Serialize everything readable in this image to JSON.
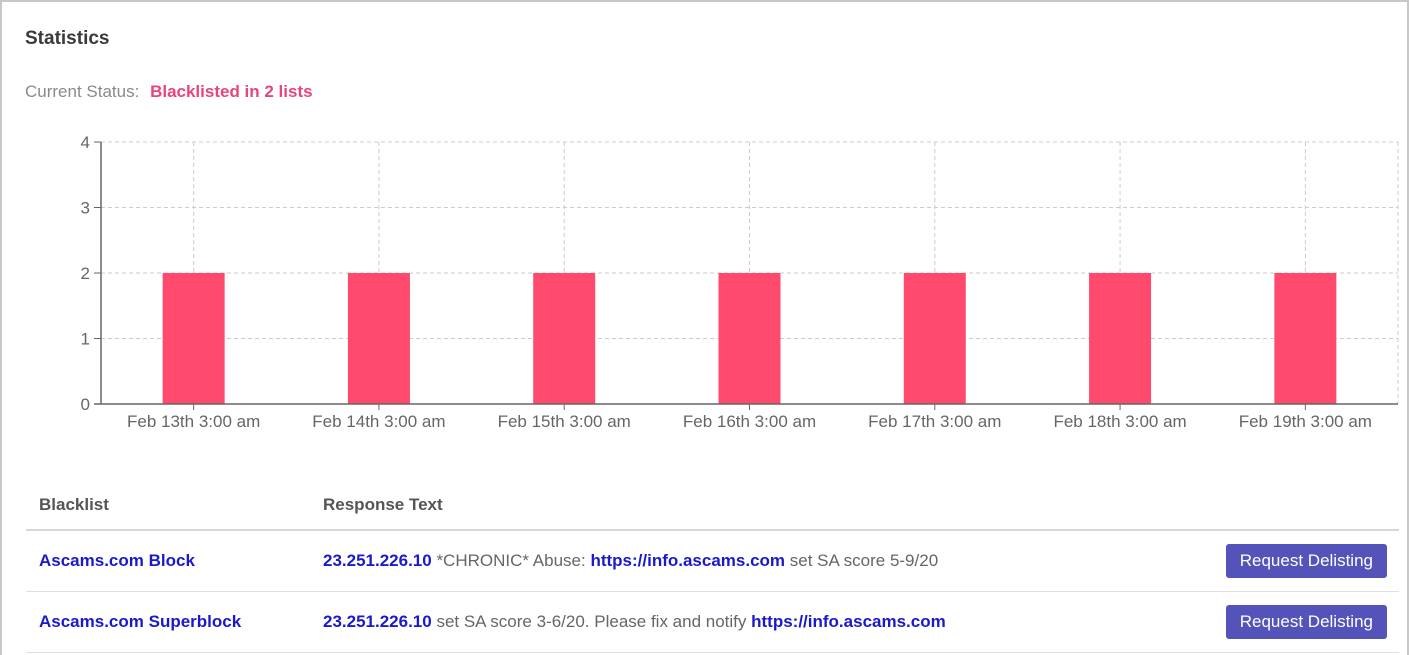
{
  "panel": {
    "title": "Statistics"
  },
  "status": {
    "label": "Current Status:",
    "value": "Blacklisted in 2 lists"
  },
  "colors": {
    "bar": "#ff4a6e",
    "status": "#e8457a",
    "link": "#1a1acc",
    "button": "#5353b9"
  },
  "chart_data": {
    "type": "bar",
    "categories": [
      "Feb 13th 3:00 am",
      "Feb 14th 3:00 am",
      "Feb 15th 3:00 am",
      "Feb 16th 3:00 am",
      "Feb 17th 3:00 am",
      "Feb 18th 3:00 am",
      "Feb 19th 3:00 am"
    ],
    "values": [
      2,
      2,
      2,
      2,
      2,
      2,
      2
    ],
    "title": "",
    "xlabel": "",
    "ylabel": "",
    "ylim": [
      0,
      4
    ],
    "yticks": [
      0,
      1,
      2,
      3,
      4
    ],
    "grid": true,
    "color": "#ff4a6e"
  },
  "table": {
    "headers": {
      "blacklist": "Blacklist",
      "response": "Response Text"
    },
    "rows": [
      {
        "name": "Ascams.com Block",
        "ip": "23.251.226.10",
        "text_before": " *CHRONIC* Abuse: ",
        "link": "https://info.ascams.com",
        "text_after": " set SA score 5-9/20",
        "action": "Request Delisting"
      },
      {
        "name": "Ascams.com Superblock",
        "ip": "23.251.226.10",
        "text_before": " set SA score 3-6/20. Please fix and notify ",
        "link": "https://info.ascams.com",
        "text_after": "",
        "action": "Request Delisting"
      }
    ]
  }
}
